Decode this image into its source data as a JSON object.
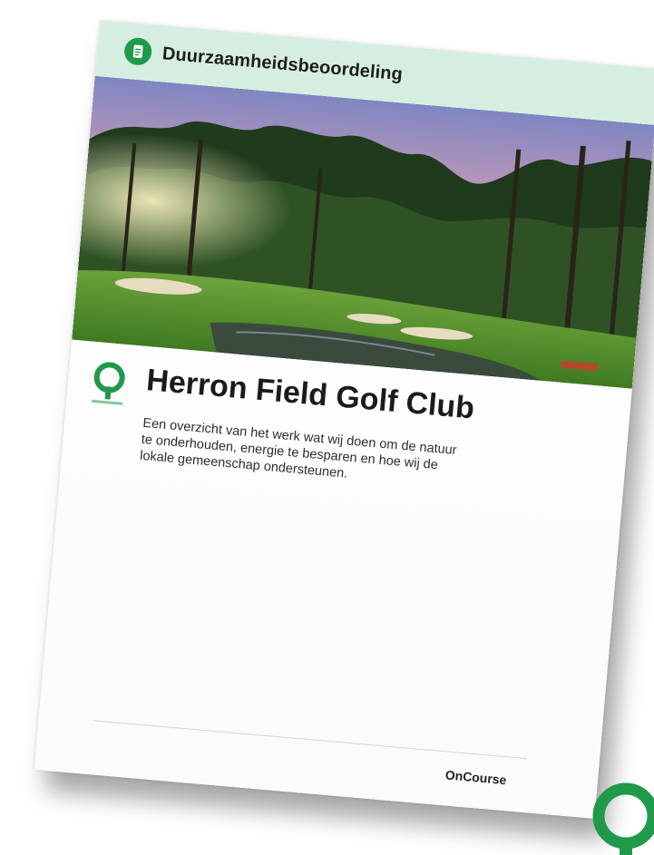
{
  "document": {
    "header_title": "Duurzaamheidsbeoordeling",
    "club_name": "Herron Field Golf Club",
    "description": "Een overzicht van het werk wat wij doen om de natuur te onderhouden, energie te besparen en hoe wij de lokale gemeenschap ondersteunen.",
    "footer_brand": "OnCourse"
  },
  "icons": {
    "header_icon": "document-icon",
    "club_logo": "golf-pin-logo",
    "corner_logo": "golf-pin-logo"
  },
  "colors": {
    "header_band": "#d6eee0",
    "brand_green": "#1f9a4a"
  }
}
